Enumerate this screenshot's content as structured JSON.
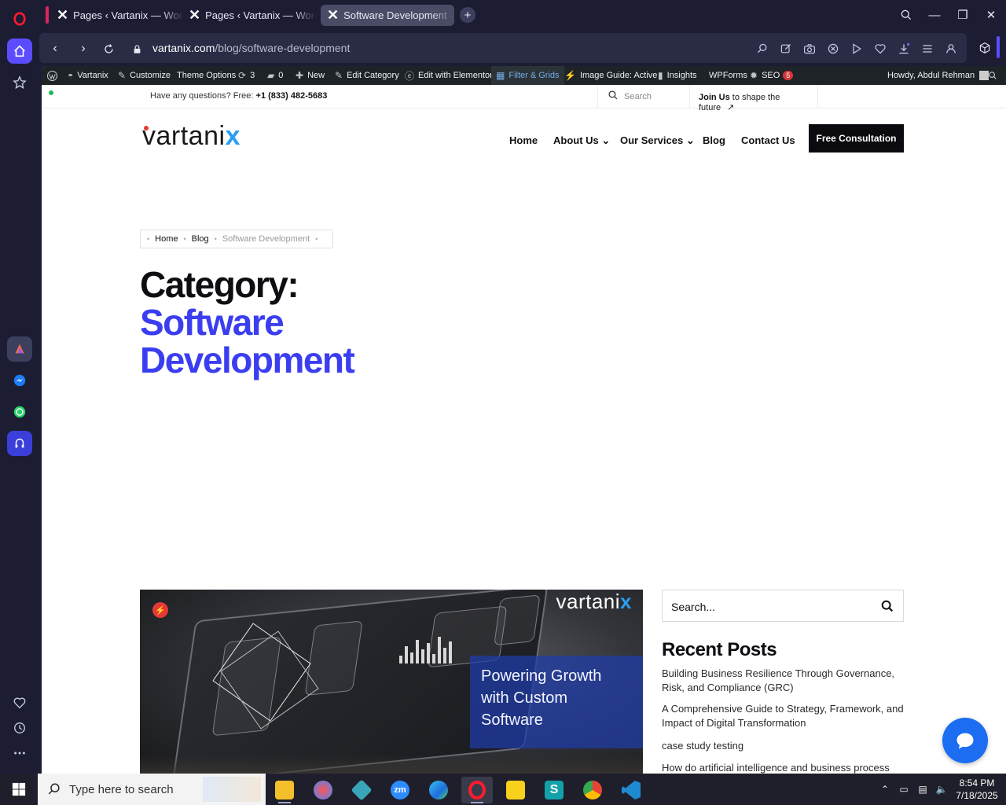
{
  "browser": {
    "tabs": [
      {
        "label": "Pages ‹ Vartanix — WordPress",
        "active": false
      },
      {
        "label": "Pages ‹ Vartanix — WordPress",
        "active": false
      },
      {
        "label": "Software Development - Vartanix",
        "active": true
      }
    ],
    "url_host": "vartanix.com",
    "url_path": "/blog/software-development"
  },
  "wp_admin_bar": {
    "site": "Vartanix",
    "customize": "Customize",
    "theme_options": "Theme Options",
    "updates": "3",
    "comments": "0",
    "new": "New",
    "edit_category": "Edit Category",
    "edit_elementor": "Edit with Elementor",
    "filter_grids": "Filter & Grids",
    "image_guide": "Image Guide: Active",
    "insights": "Insights",
    "wpforms": "WPForms",
    "seo": "SEO",
    "seo_count": "5",
    "howdy": "Howdy, Abdul Rehman"
  },
  "infobar": {
    "question": "Have any questions? Free: ",
    "phone": "+1 (833) 482-5683",
    "search_placeholder": "Search",
    "join_bold": "Join Us",
    "join_rest": " to shape the future"
  },
  "header": {
    "logo_text": "vartani",
    "logo_x": "x",
    "menu": [
      "Home",
      "About Us",
      "Our Services",
      "Blog",
      "Contact Us"
    ],
    "cta": "Free Consultation"
  },
  "breadcrumb": {
    "items": [
      "Home",
      "Blog",
      "Software Development"
    ]
  },
  "page": {
    "title_prefix": "Category:",
    "title_line1": "Software",
    "title_line2": "Development"
  },
  "featured": {
    "brand": "vartani",
    "brand_x": "x",
    "overlay_line1": "Powering Growth",
    "overlay_line2": "with Custom",
    "overlay_line3": "Software"
  },
  "sidebar": {
    "search_placeholder": "Search...",
    "recent_title": "Recent Posts",
    "recent_posts": [
      "Building Business Resilience Through Governance, Risk, and Compliance (GRC)",
      "A Comprehensive Guide to Strategy, Framework, and Impact of Digital Transformation",
      "case study testing",
      "How do artificial intelligence and business process"
    ]
  },
  "taskbar": {
    "search_placeholder": "Type here to search",
    "time": "8:54 PM",
    "date": "7/18/2025"
  },
  "colors": {
    "accent_blue": "#3b3ef0",
    "brand_x": "#2a9df4",
    "cta_bg": "#0b0b0f",
    "chat": "#1c6df2"
  }
}
